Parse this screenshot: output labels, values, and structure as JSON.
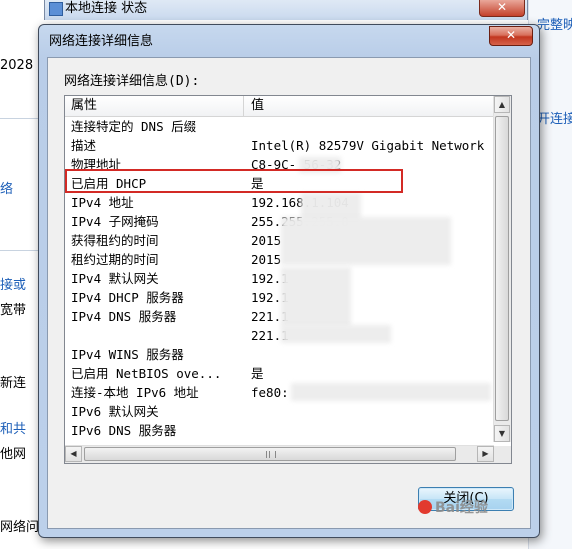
{
  "background": {
    "window_title": "本地连接 状态",
    "left_fragments": [
      "2028",
      "络",
      "接或",
      "宽带",
      "新连",
      "和共",
      "他网",
      "网络问"
    ],
    "right_fragments": [
      "完整映射",
      "开连接"
    ]
  },
  "dialog": {
    "title": "网络连接详细信息",
    "close_glyph": "✕",
    "list_label": "网络连接详细信息(D):",
    "columns": {
      "property": "属性",
      "value": "值"
    },
    "rows": [
      {
        "property": "连接特定的 DNS 后缀",
        "value": ""
      },
      {
        "property": "描述",
        "value": "Intel(R) 82579V Gigabit Network"
      },
      {
        "property": "物理地址",
        "value": "C8-9C-        56-32"
      },
      {
        "property": "已启用 DHCP",
        "value": "是"
      },
      {
        "property": "IPv4 地址",
        "value": "192.168.1.104"
      },
      {
        "property": "IPv4 子网掩码",
        "value": "255.255.255.0"
      },
      {
        "property": "获得租约的时间",
        "value": "2015"
      },
      {
        "property": "租约过期的时间",
        "value": "2015"
      },
      {
        "property": "IPv4 默认网关",
        "value": "192.1"
      },
      {
        "property": "IPv4 DHCP 服务器",
        "value": "192.1"
      },
      {
        "property": "IPv4 DNS 服务器",
        "value": "221.1"
      },
      {
        "property": "",
        "value": "221.1"
      },
      {
        "property": "IPv4 WINS 服务器",
        "value": ""
      },
      {
        "property": "已启用 NetBIOS ove...",
        "value": "是"
      },
      {
        "property": "连接-本地 IPv6 地址",
        "value": "fe80:"
      },
      {
        "property": "IPv6 默认网关",
        "value": ""
      },
      {
        "property": "IPv6 DNS 服务器",
        "value": ""
      }
    ],
    "highlight_color": "#d32a25",
    "close_button_label": "关闭(C)"
  },
  "icons": {
    "scroll_up": "▲",
    "scroll_down": "▼",
    "scroll_left": "◀",
    "scroll_right": "▶"
  },
  "watermark": "Bai经验"
}
